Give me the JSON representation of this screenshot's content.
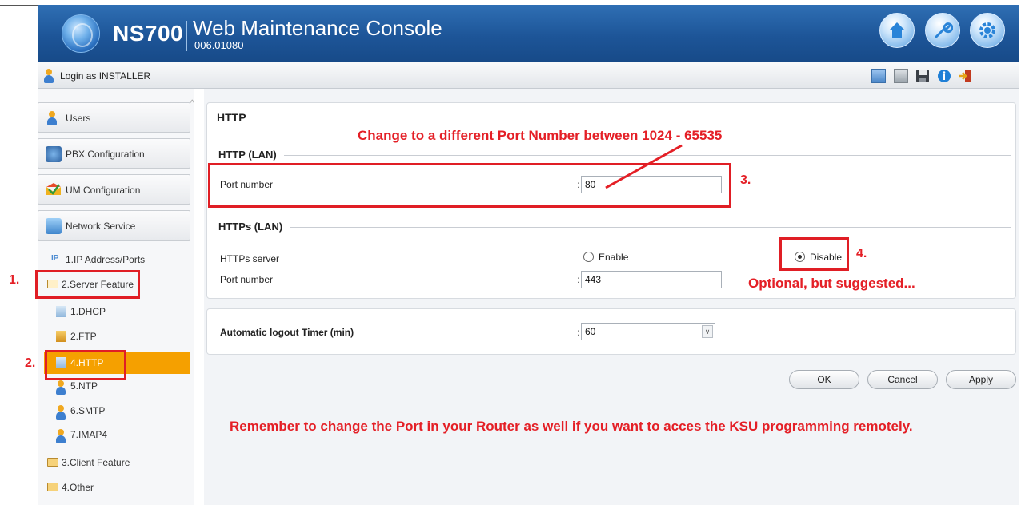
{
  "header": {
    "model": "NS700",
    "console_title": "Web Maintenance Console",
    "version": "006.01080",
    "icons": [
      "home-icon",
      "wrench-icon",
      "gear-icon"
    ]
  },
  "subbar": {
    "login_text": "Login as INSTALLER",
    "tools": [
      "calendar-icon",
      "phone-book-icon",
      "save-icon",
      "info-icon",
      "logout-icon"
    ]
  },
  "sidebar": {
    "sections": [
      "Users",
      "PBX Configuration",
      "UM Configuration",
      "Network Service"
    ],
    "tree": {
      "ip": "1.IP Address/Ports",
      "server_feature": "2.Server Feature",
      "dhcp": "1.DHCP",
      "ftp": "2.FTP",
      "http": "4.HTTP",
      "ntp": "5.NTP",
      "smtp": "6.SMTP",
      "imap": "7.IMAP4",
      "client_feature": "3.Client Feature",
      "other": "4.Other"
    }
  },
  "main": {
    "title": "HTTP",
    "http_lan": {
      "group": "HTTP (LAN)",
      "port_label": "Port number",
      "port_value": "80"
    },
    "https_lan": {
      "group": "HTTPs (LAN)",
      "server_label": "HTTPs server",
      "enable": "Enable",
      "disable": "Disable",
      "selected": "Disable",
      "port_label": "Port number",
      "port_value": "443"
    },
    "logout": {
      "label": "Automatic logout Timer (min)",
      "value": "60"
    },
    "buttons": {
      "ok": "OK",
      "cancel": "Cancel",
      "apply": "Apply"
    }
  },
  "annotations": {
    "step1": "1.",
    "step2": "2.",
    "step3": "3.",
    "step4": "4.",
    "port_range": "Change to a different Port Number between 1024 - 65535",
    "optional": "Optional, but suggested...",
    "reminder": "Remember to change the Port in your Router as well if you want to acces the KSU programming remotely."
  },
  "colors": {
    "header_blue": "#1d5598",
    "selected_orange": "#f5a000",
    "annotation_red": "#e41f26"
  }
}
